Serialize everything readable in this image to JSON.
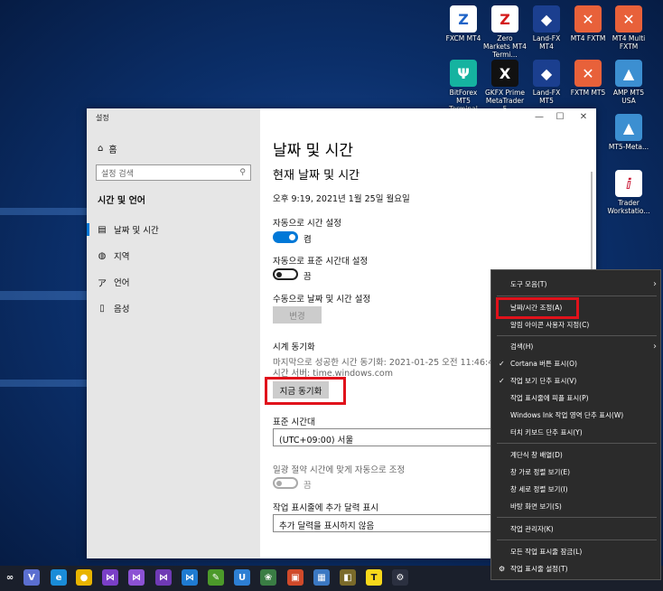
{
  "desktop": {
    "icons": [
      {
        "name": "fxcm-mt4-icon",
        "label": "FXCM MT4",
        "glyph": "Z",
        "bg": "#ffffff",
        "fg": "#1e63c7"
      },
      {
        "name": "zero-markets-mt4-icon",
        "label": "Zero Markets MT4 Termi...",
        "glyph": "Z",
        "bg": "#ffffff",
        "fg": "#d41a1a"
      },
      {
        "name": "land-fx-mt4-icon",
        "label": "Land-FX MT4",
        "glyph": "◆",
        "bg": "#1b3f8f",
        "fg": "#ffffff"
      },
      {
        "name": "mt4-fxtm-icon",
        "label": "MT4 FXTM",
        "glyph": "✕",
        "bg": "#e8613a",
        "fg": "#ffffff"
      },
      {
        "name": "mt4-multi-fxtm-icon",
        "label": "MT4 Multi FXTM",
        "glyph": "✕",
        "bg": "#e8613a",
        "fg": "#ffffff"
      },
      {
        "name": "bitforex-mt5-icon",
        "label": "BitForex MT5 Terminal",
        "glyph": "Ψ",
        "bg": "#15b3a0",
        "fg": "#ffffff"
      },
      {
        "name": "gkfx-prime-mt5-icon",
        "label": "GKFX Prime MetaTrader 5",
        "glyph": "X",
        "bg": "#111111",
        "fg": "#ffffff"
      },
      {
        "name": "land-fx-mt5-icon",
        "label": "Land-FX MT5",
        "glyph": "◆",
        "bg": "#1b3f8f",
        "fg": "#ffffff"
      },
      {
        "name": "fxtm-mt5-icon",
        "label": "FXTM MT5",
        "glyph": "✕",
        "bg": "#e8613a",
        "fg": "#ffffff"
      },
      {
        "name": "amp-mt5-usa-icon",
        "label": "AMP MT5 USA",
        "glyph": "▲",
        "bg": "#3c8fd1",
        "fg": "#ffffff"
      },
      {
        "name": "mt5-meta-icon",
        "label": "MT5-Meta...",
        "glyph": "▲",
        "bg": "#3c8fd1",
        "fg": "#ffffff"
      },
      {
        "name": "trader-workstation-icon",
        "label": "Trader Workstatio...",
        "glyph": "ⅈ",
        "bg": "#ffffff",
        "fg": "#c8102e"
      }
    ]
  },
  "settings": {
    "window_title": "설정",
    "controls": {
      "minimize": "—",
      "maximize": "☐",
      "close": "✕"
    },
    "sidebar": {
      "home": "홈",
      "search_placeholder": "설정 검색",
      "section": "시간 및 언어",
      "items": [
        {
          "label": "날짜 및 시간",
          "icon": "calendar-icon",
          "glyph": "▤"
        },
        {
          "label": "지역",
          "icon": "globe-icon",
          "glyph": "◍"
        },
        {
          "label": "언어",
          "icon": "language-icon",
          "glyph": "ア"
        },
        {
          "label": "음성",
          "icon": "microphone-icon",
          "glyph": "▯"
        }
      ]
    },
    "main": {
      "title": "날짜 및 시간",
      "subtitle": "현재 날짜 및 시간",
      "current_datetime": "오후 9:19, 2021년 1월 25일 월요일",
      "auto_time_label": "자동으로 시간 설정",
      "auto_time_state": "켬",
      "auto_timezone_label": "자동으로 표준 시간대 설정",
      "auto_timezone_state": "끔",
      "manual_label": "수동으로 날짜 및 시간 설정",
      "change_button": "변경",
      "sync_heading": "시계 동기화",
      "last_sync": "마지막으로 성공한 시간 동기화: 2021-01-25 오전 11:46:42",
      "time_server": "시간 서버: time.windows.com",
      "sync_now_button": "지금 동기화",
      "timezone_label": "표준 시간대",
      "timezone_value": "(UTC+09:00) 서울",
      "dst_label": "일광 절약 시간에 맞게 자동으로 조정",
      "dst_state": "끔",
      "additional_calendar_label": "작업 표시줄에 추가 달력 표시",
      "additional_calendar_value": "추가 달력을 표시하지 않음"
    }
  },
  "context_menu": {
    "items": [
      {
        "label": "도구 모음(T)",
        "submenu": true,
        "checked": false,
        "highlight": false
      },
      {
        "label": "날짜/시간 조정(A)",
        "submenu": false,
        "checked": false,
        "highlight": true
      },
      {
        "label": "알림 아이콘 사용자 지정(C)",
        "submenu": false,
        "checked": false,
        "highlight": false
      },
      {
        "label": "검색(H)",
        "submenu": true,
        "checked": false,
        "highlight": false
      },
      {
        "label": "Cortana 버튼 표시(O)",
        "submenu": false,
        "checked": true,
        "highlight": false
      },
      {
        "label": "작업 보기 단추 표시(V)",
        "submenu": false,
        "checked": true,
        "highlight": false
      },
      {
        "label": "작업 표시줄에 피플 표시(P)",
        "submenu": false,
        "checked": false,
        "highlight": false
      },
      {
        "label": "Windows Ink 작업 영역 단추 표시(W)",
        "submenu": false,
        "checked": false,
        "highlight": false
      },
      {
        "label": "터치 키보드 단추 표시(Y)",
        "submenu": false,
        "checked": false,
        "highlight": false
      },
      {
        "label": "계단식 창 배열(D)",
        "submenu": false,
        "checked": false,
        "highlight": false
      },
      {
        "label": "창 가로 정렬 보기(E)",
        "submenu": false,
        "checked": false,
        "highlight": false
      },
      {
        "label": "창 세로 정렬 보기(I)",
        "submenu": false,
        "checked": false,
        "highlight": false
      },
      {
        "label": "바탕 화면 보기(S)",
        "submenu": false,
        "checked": false,
        "highlight": false
      },
      {
        "label": "작업 관리자(K)",
        "submenu": false,
        "checked": false,
        "highlight": false
      },
      {
        "label": "모든 작업 표시줄 잠금(L)",
        "submenu": false,
        "checked": false,
        "highlight": false
      },
      {
        "label": "작업 표시줄 설정(T)",
        "submenu": false,
        "checked": false,
        "highlight": false,
        "gear": true
      }
    ]
  },
  "taskbar": {
    "icons": [
      {
        "name": "infinity-app-icon",
        "glyph": "∞",
        "bg": "#1a1f2b"
      },
      {
        "name": "visual-studio-code-icon",
        "glyph": "V",
        "bg": "#5b6fd0"
      },
      {
        "name": "edge-browser-icon",
        "glyph": "e",
        "bg": "#1a8cd8"
      },
      {
        "name": "chrome-browser-icon",
        "glyph": "●",
        "bg": "#e8b400"
      },
      {
        "name": "visual-studio-icon",
        "glyph": "⋈",
        "bg": "#7a3fc6"
      },
      {
        "name": "visual-studio-2-icon",
        "glyph": "⋈",
        "bg": "#8c52d4"
      },
      {
        "name": "visual-studio-3-icon",
        "glyph": "⋈",
        "bg": "#6f3ab4"
      },
      {
        "name": "vscode-blue-icon",
        "glyph": "⋈",
        "bg": "#1f7bd1"
      },
      {
        "name": "notepad-plus-icon",
        "glyph": "✎",
        "bg": "#4c9a2a"
      },
      {
        "name": "app-u-icon",
        "glyph": "U",
        "bg": "#2d7fd3"
      },
      {
        "name": "paint-icon",
        "glyph": "❀",
        "bg": "#3a7d44"
      },
      {
        "name": "presentation-icon",
        "glyph": "▣",
        "bg": "#d04a2a"
      },
      {
        "name": "calculator-icon",
        "glyph": "▦",
        "bg": "#3b78c2"
      },
      {
        "name": "photo-app-icon",
        "glyph": "◧",
        "bg": "#7a6a2a"
      },
      {
        "name": "kakaotalk-icon",
        "glyph": "T",
        "bg": "#f7d81b"
      },
      {
        "name": "settings-gear-icon",
        "glyph": "⚙",
        "bg": "#2b3040"
      }
    ]
  },
  "colors": {
    "accent": "#0078d7",
    "highlight_box": "#e0121b"
  }
}
